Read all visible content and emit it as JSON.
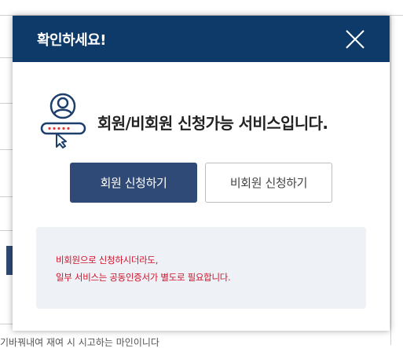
{
  "modal": {
    "title": "확인하세요!",
    "close_icon": "close-icon",
    "headline": "회원/비회원 신청가능 서비스입니다.",
    "service_icon": "member-service-icon",
    "buttons": {
      "member": "회원 신청하기",
      "nonmember": "비회원 신청하기"
    },
    "notice": {
      "line1": "비회원으로 신청하시더라도,",
      "line2": "일부 서비스는 공동인증서가 별도로 필요합니다."
    }
  },
  "background": {
    "bottom_text": "기바꿔내여 재여 시 시고하는 마인이니다"
  },
  "colors": {
    "header": "#0d3a68",
    "primary_button": "#2f4a76",
    "notice_text": "#d0112b",
    "notice_bg": "#eef2f6"
  }
}
